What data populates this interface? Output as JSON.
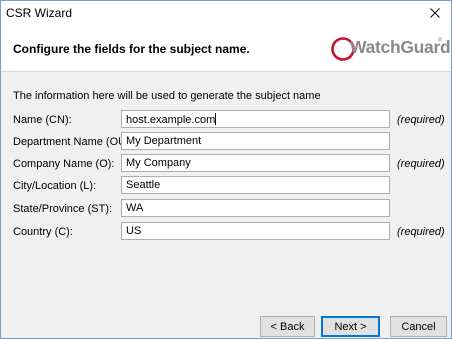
{
  "window": {
    "title": "CSR Wizard"
  },
  "header": {
    "title": "Configure the fields for the subject name.",
    "logo_text": "WatchGuard",
    "logo_mark": "®"
  },
  "intro": "The information here will be used to generate the subject name",
  "fields": [
    {
      "label": "Name (CN):",
      "value": "host.example.com",
      "required": "(required)"
    },
    {
      "label": "Department Name (OU):",
      "value": "My Department",
      "required": ""
    },
    {
      "label": "Company Name (O):",
      "value": "My Company",
      "required": "(required)"
    },
    {
      "label": "City/Location (L):",
      "value": "Seattle",
      "required": ""
    },
    {
      "label": "State/Province (ST):",
      "value": "WA",
      "required": ""
    },
    {
      "label": "Country (C):",
      "value": "US",
      "required": "(required)"
    }
  ],
  "buttons": {
    "back": "< Back",
    "next": "Next >",
    "cancel": "Cancel"
  },
  "colors": {
    "logo_red": "#c8102e",
    "logo_gray": "#8a8a8a",
    "focus_blue": "#0078d7"
  },
  "icons": {
    "close": "close-icon",
    "logo": "watchguard-logo-icon"
  }
}
